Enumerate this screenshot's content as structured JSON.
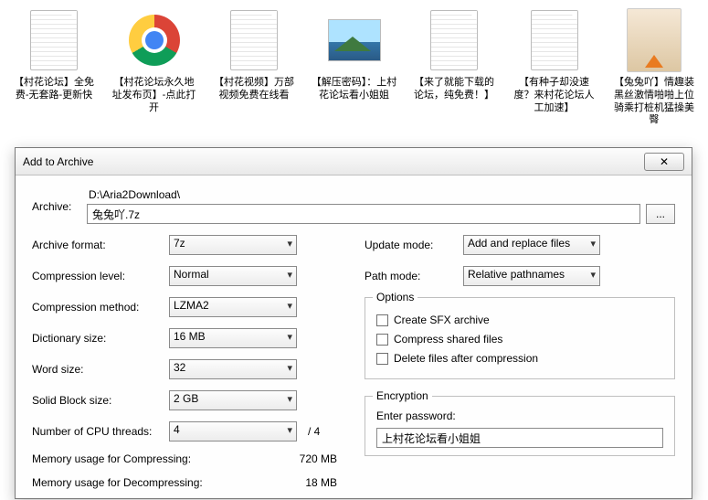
{
  "desktop": [
    {
      "name": "file-1",
      "label": "【村花论坛】全免费-无套路-更新快",
      "kind": "text"
    },
    {
      "name": "file-2",
      "label": "【村花论坛永久地址发布页】-点此打开",
      "kind": "chrome"
    },
    {
      "name": "file-3",
      "label": "【村花视频】万部视频免费在线看",
      "kind": "text"
    },
    {
      "name": "file-4",
      "label": "【解压密码】：上村花论坛看小姐姐",
      "kind": "photo"
    },
    {
      "name": "file-5",
      "label": "【来了就能下载的论坛，纯免费！】",
      "kind": "text"
    },
    {
      "name": "file-6",
      "label": "【有种子却没速度？来村花论坛人工加速】",
      "kind": "text"
    },
    {
      "name": "file-7",
      "label": "【兔兔吖】情趣装黑丝激情啪啪上位骑乘打桩机猛操美臀",
      "kind": "video"
    }
  ],
  "dialog": {
    "title": "Add to Archive",
    "close": "✕",
    "archiveLabel": "Archive:",
    "archivePath": "D:\\Aria2Download\\",
    "archiveName": "兔兔吖.7z",
    "browse": "...",
    "left": {
      "format": {
        "label": "Archive format:",
        "value": "7z"
      },
      "level": {
        "label": "Compression level:",
        "value": "Normal"
      },
      "method": {
        "label": "Compression method:",
        "value": "LZMA2"
      },
      "dict": {
        "label": "Dictionary size:",
        "value": "16 MB"
      },
      "word": {
        "label": "Word size:",
        "value": "32"
      },
      "block": {
        "label": "Solid Block size:",
        "value": "2 GB"
      },
      "threads": {
        "label": "Number of CPU threads:",
        "value": "4",
        "max": "/ 4"
      },
      "memc": {
        "label": "Memory usage for Compressing:",
        "value": "720 MB"
      },
      "memd": {
        "label": "Memory usage for Decompressing:",
        "value": "18 MB"
      }
    },
    "right": {
      "update": {
        "label": "Update mode:",
        "value": "Add and replace files"
      },
      "path": {
        "label": "Path mode:",
        "value": "Relative pathnames"
      },
      "options": {
        "title": "Options",
        "sfx": "Create SFX archive",
        "shared": "Compress shared files",
        "delete": "Delete files after compression"
      },
      "enc": {
        "title": "Encryption",
        "label": "Enter password:",
        "value": "上村花论坛看小姐姐"
      }
    }
  }
}
